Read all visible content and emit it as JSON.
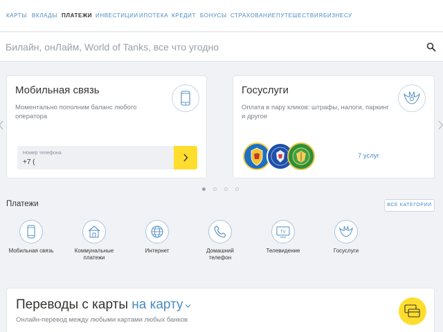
{
  "nav": {
    "items": [
      "Карты",
      "Вклады",
      "Платежи",
      "Инвестиции",
      "Ипотека",
      "Кредит",
      "Бонусы",
      "Страхование",
      "Путешествия",
      "Бизнесу"
    ],
    "active_index": 2
  },
  "search": {
    "placeholder": "Билайн, онЛайм, World of Tanks, все что угодно",
    "icon": "search-icon"
  },
  "mobile_card": {
    "title": "Мобильная связь",
    "description": "Моментально пополним баланс любого оператора",
    "icon": "smartphone-icon",
    "phone_label": "Номер телефона",
    "phone_value": "+7 (",
    "submit_icon": "chevron-right-icon"
  },
  "gos_card": {
    "title": "Госуслуги",
    "description": "Оплата в пару кликов: штрафы, налоги, паркинг и другое",
    "icon": "eagle-emblem-icon",
    "services_link": "7 услуг",
    "emblems": [
      "gibdd-emblem",
      "fns-emblem",
      "fssp-emblem"
    ]
  },
  "carousel": {
    "pages": 4,
    "active": 0
  },
  "payments": {
    "title": "Платежи",
    "all_categories": "ВСЕ КАТЕГОРИИ",
    "categories": [
      {
        "label": "Мобильная связь",
        "icon": "smartphone-icon"
      },
      {
        "label": "Коммунальные платежи",
        "icon": "house-icon"
      },
      {
        "label": "Интернет",
        "icon": "globe-icon"
      },
      {
        "label": "Домашний телефон",
        "icon": "phone-handset-icon"
      },
      {
        "label": "Телевидение",
        "icon": "tv-icon"
      },
      {
        "label": "Госуслуги",
        "icon": "eagle-emblem-icon"
      }
    ]
  },
  "transfer": {
    "title_prefix": "Переводы с карты",
    "title_link": "на карту",
    "subtitle": "Онлайн-перевод между любыми картами любых банков",
    "icon": "cards-icon"
  },
  "colors": {
    "accent": "#4a8bc2",
    "yellow": "#ffdd2d",
    "background": "#f0f2f5"
  }
}
